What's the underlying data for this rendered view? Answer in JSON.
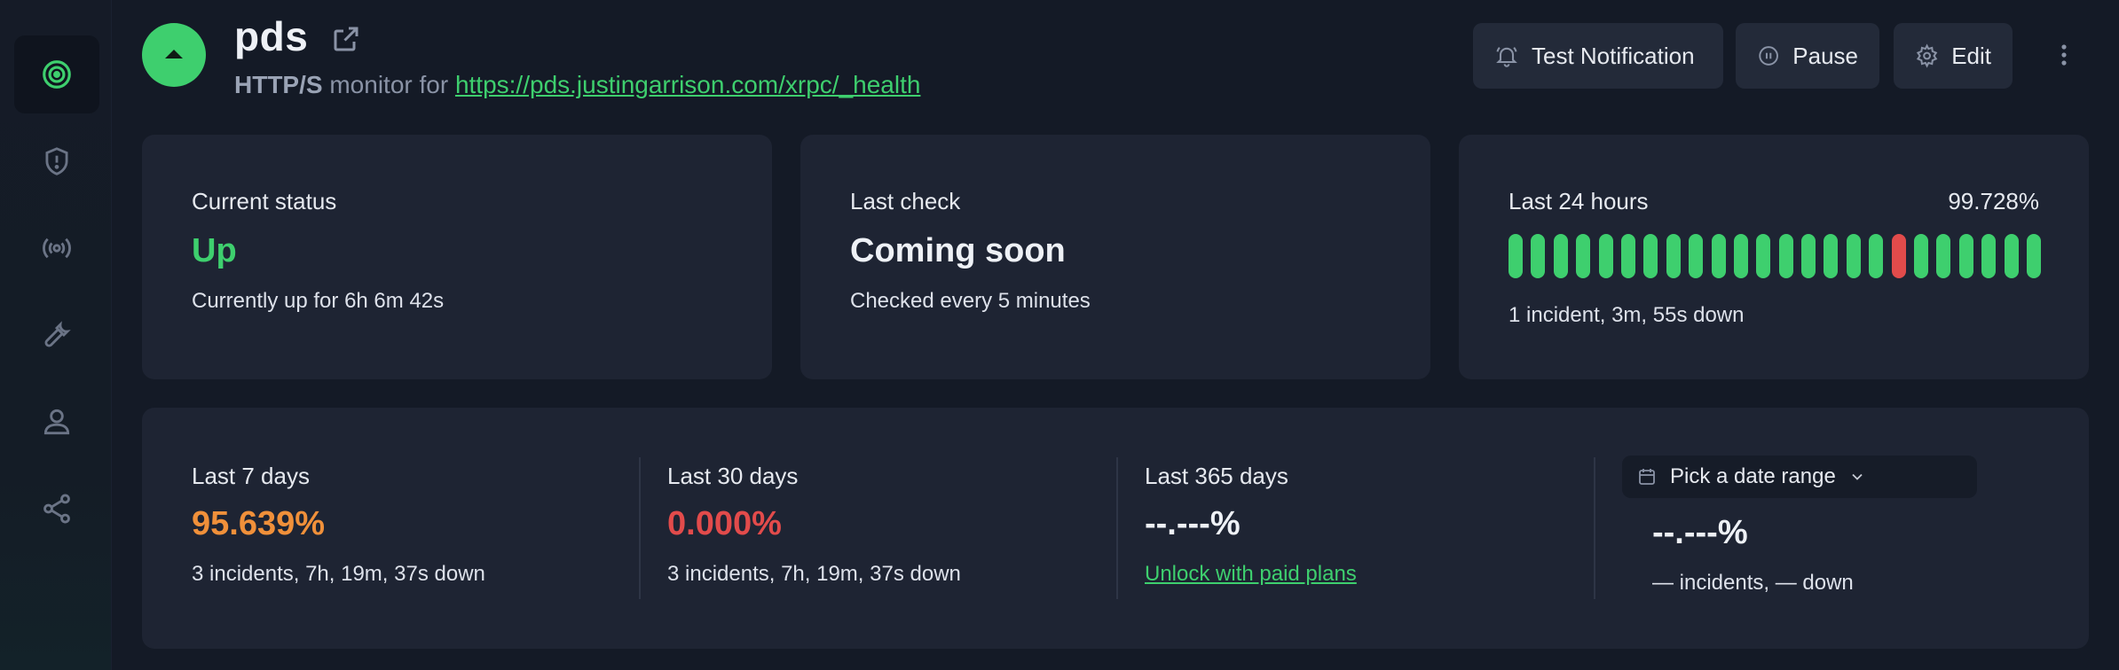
{
  "sidebar": {
    "items": [
      {
        "icon": "monitor-target-icon",
        "active": true
      },
      {
        "icon": "shield-alert-icon",
        "active": false
      },
      {
        "icon": "broadcast-icon",
        "active": false
      },
      {
        "icon": "wrench-icon",
        "active": false
      },
      {
        "icon": "user-icon",
        "active": false
      },
      {
        "icon": "share-icon",
        "active": false
      }
    ]
  },
  "header": {
    "title": "pds",
    "protocol": "HTTP/S",
    "monitor_for": "monitor for",
    "url": "https://pds.justingarrison.com/xrpc/_health",
    "status_color": "#3ecf6e"
  },
  "actions": {
    "test_notification": "Test Notification",
    "pause": "Pause",
    "edit": "Edit"
  },
  "cards": {
    "current_status": {
      "label": "Current status",
      "value": "Up",
      "note": "Currently up for 6h 6m 42s"
    },
    "last_check": {
      "label": "Last check",
      "value": "Coming soon",
      "note": "Checked every 5 minutes"
    },
    "last_24h": {
      "label": "Last 24 hours",
      "percent": "99.728%",
      "note": "1 incident, 3m, 55s down",
      "bars": [
        "up",
        "up",
        "up",
        "up",
        "up",
        "up",
        "up",
        "up",
        "up",
        "up",
        "up",
        "up",
        "up",
        "up",
        "up",
        "up",
        "up",
        "down",
        "up",
        "up",
        "up",
        "up",
        "up",
        "up"
      ]
    }
  },
  "periods": {
    "d7": {
      "label": "Last 7 days",
      "value": "95.639%",
      "note": "3 incidents, 7h, 19m, 37s down"
    },
    "d30": {
      "label": "Last 30 days",
      "value": "0.000%",
      "note": "3 incidents, 7h, 19m, 37s down"
    },
    "d365": {
      "label": "Last 365 days",
      "value": "--.---%",
      "link": "Unlock with paid plans"
    },
    "custom": {
      "picker": "Pick a date range",
      "value": "--.---%",
      "note": "— incidents, — down"
    }
  },
  "colors": {
    "green": "#3ecf6e",
    "red": "#e24b4b",
    "orange": "#f0903a",
    "background": "#141a26",
    "card": "#1e2433"
  }
}
